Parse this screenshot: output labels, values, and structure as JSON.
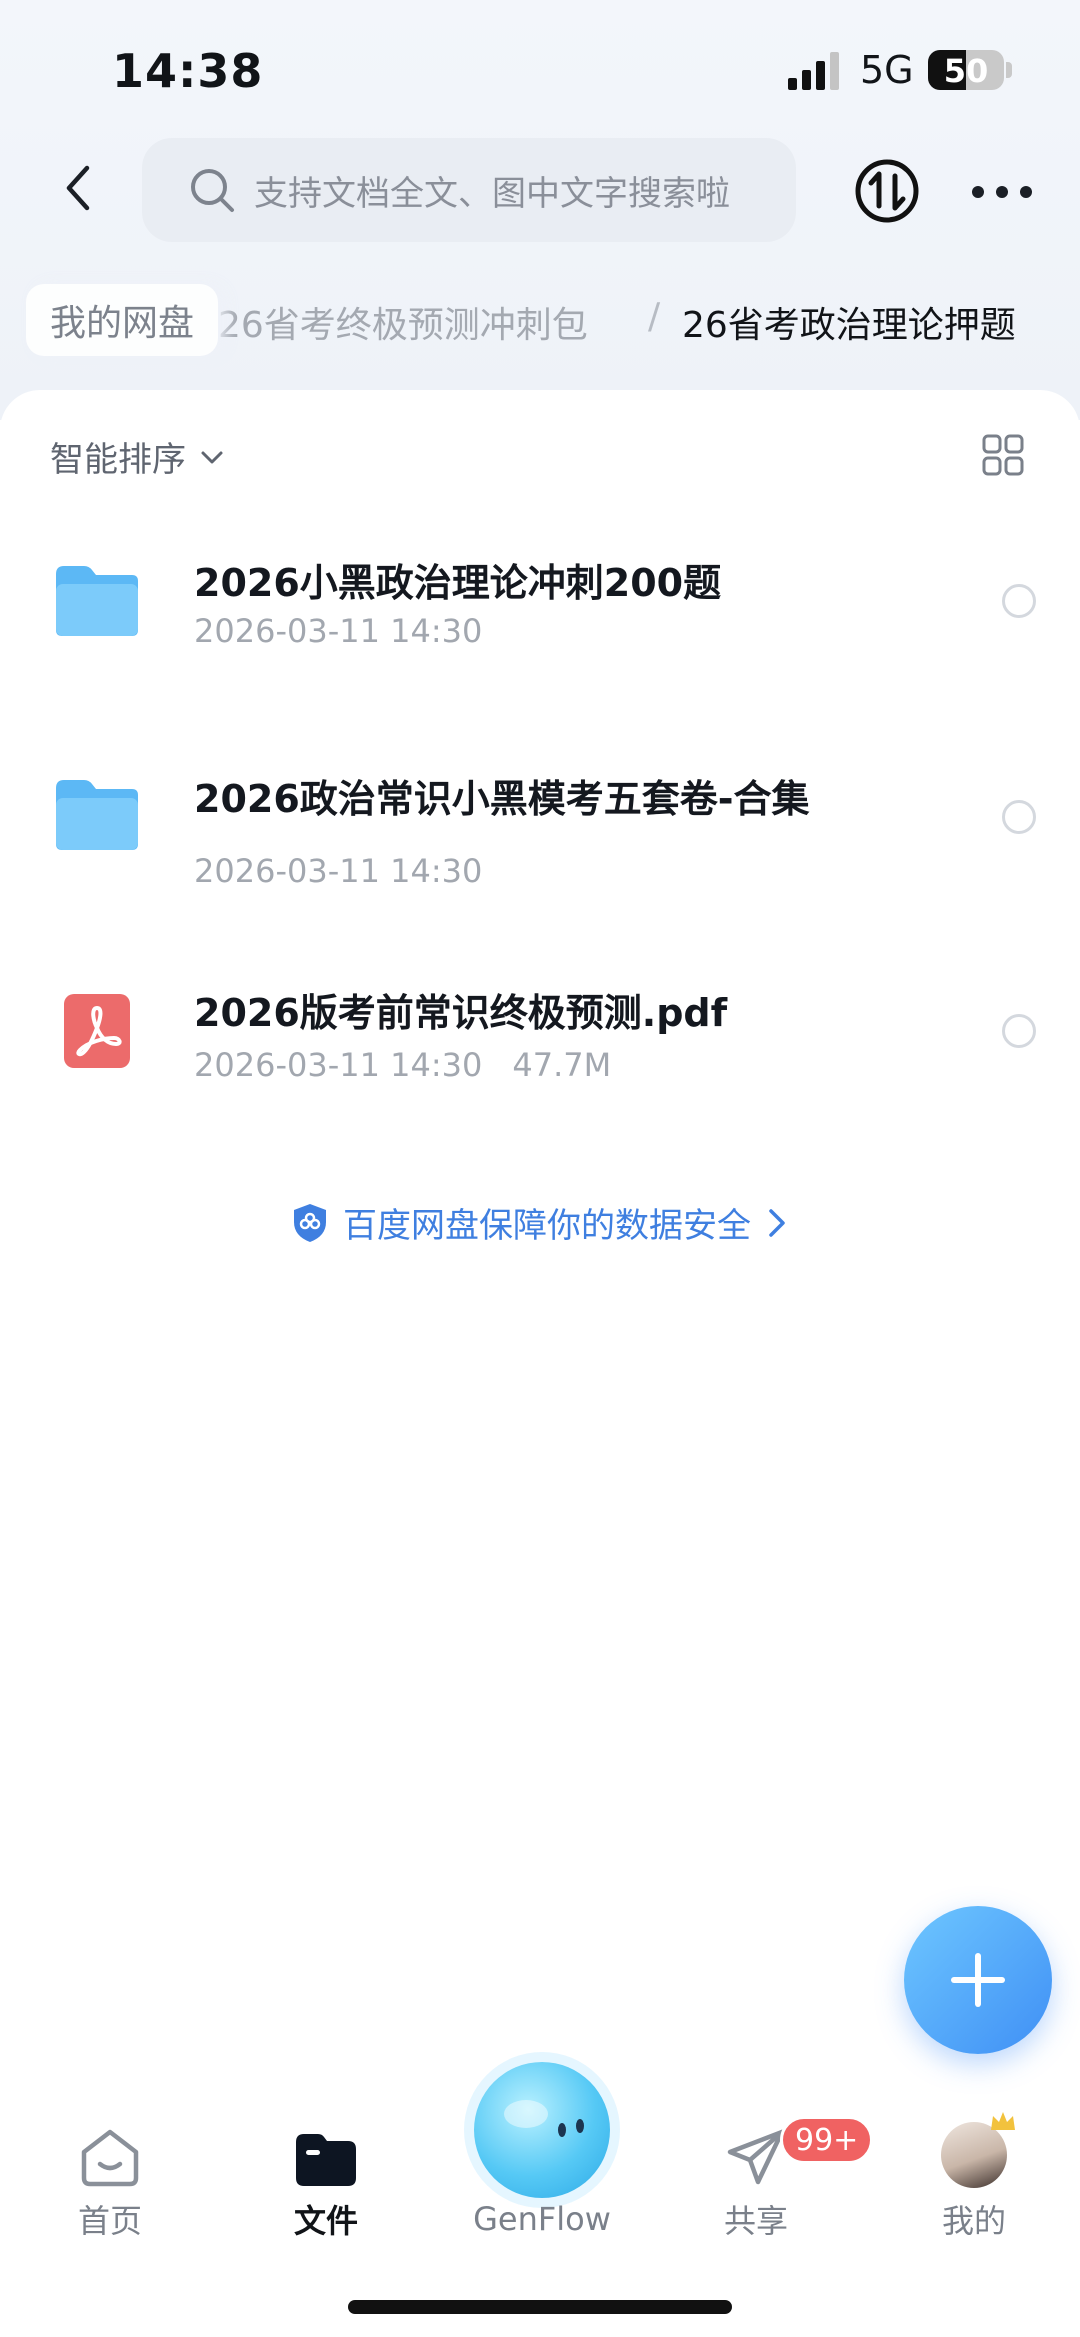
{
  "status_bar": {
    "time": "14:38",
    "network": "5G",
    "battery": "50"
  },
  "header": {
    "search_placeholder": "支持文档全文、图中文字搜索啦"
  },
  "breadcrumb": {
    "root": "我的网盘",
    "middle": "26省考终极预测冲刺包",
    "separator": "/",
    "current": "26省考政治理论押题"
  },
  "toolbar": {
    "sort_label": "智能排序"
  },
  "files": [
    {
      "type": "folder",
      "name": "2026小黑政治理论冲刺200题",
      "date": "2026-03-11 14:30",
      "size": ""
    },
    {
      "type": "folder",
      "name": "2026政治常识小黑模考五套卷-合集",
      "date": "2026-03-11 14:30",
      "size": ""
    },
    {
      "type": "pdf",
      "name": "2026版考前常识终极预测.pdf",
      "date": "2026-03-11 14:30",
      "size": "47.7M"
    }
  ],
  "security_notice": "百度网盘保障你的数据安全",
  "tabbar": {
    "home": "首页",
    "files": "文件",
    "genflow": "GenFlow",
    "share": "共享",
    "share_badge": "99+",
    "me": "我的"
  },
  "colors": {
    "accent": "#3f7fe0",
    "badge": "#f06262",
    "folder": "#5cb8f5",
    "pdf": "#ec5f5f"
  }
}
